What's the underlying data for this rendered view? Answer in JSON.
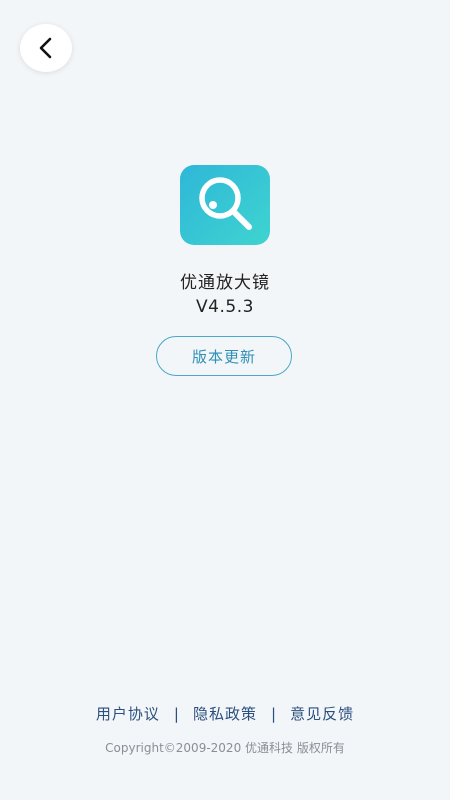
{
  "header": {
    "back_icon": "chevron-left-icon"
  },
  "app": {
    "icon": "magnifier-icon",
    "name": "优通放大镜",
    "version": "V4.5.3",
    "update_label": "版本更新"
  },
  "footer": {
    "links": [
      {
        "label": "用户协议"
      },
      {
        "label": "隐私政策"
      },
      {
        "label": "意见反馈"
      }
    ],
    "separator": "|",
    "copyright": "Copyright©2009-2020 优通科技 版权所有"
  },
  "colors": {
    "background": "#f3f6f8",
    "icon_gradient_start": "#2fb7d8",
    "icon_gradient_end": "#3ed4d0",
    "accent": "#2e8fb8",
    "link": "#2b4f7e"
  }
}
